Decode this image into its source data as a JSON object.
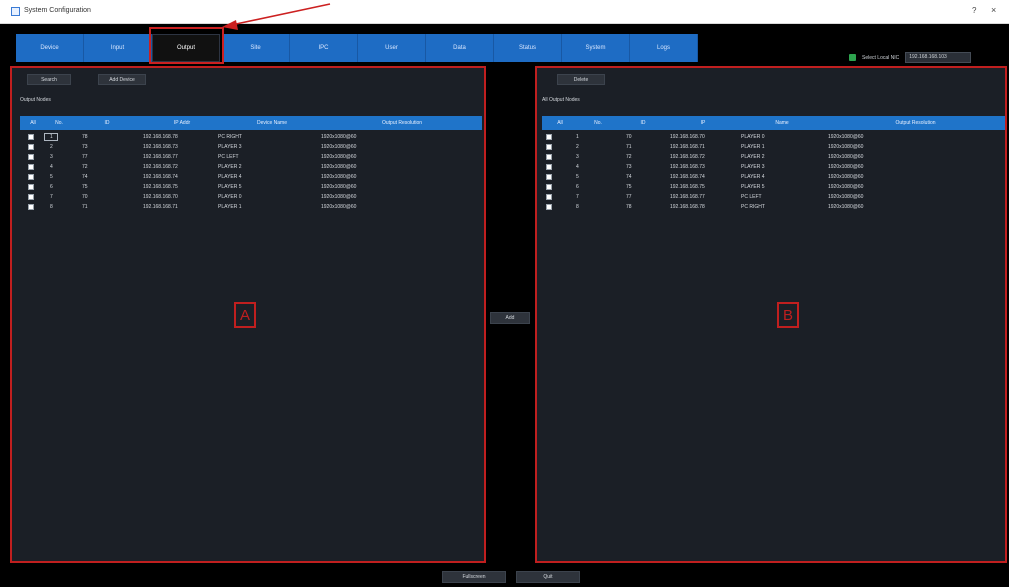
{
  "window": {
    "title": "System Configuration",
    "help": "?",
    "close": "×"
  },
  "tabs": [
    {
      "label": "Device"
    },
    {
      "label": "Input"
    },
    {
      "label": "Output"
    },
    {
      "label": "Site"
    },
    {
      "label": "IPC"
    },
    {
      "label": "User"
    },
    {
      "label": "Data"
    },
    {
      "label": "Status"
    },
    {
      "label": "System"
    },
    {
      "label": "Logs"
    }
  ],
  "active_tab": "Output",
  "local_nic": {
    "label": "Select Local NIC",
    "value": "192.168.168.103"
  },
  "panel_a": {
    "search_label": "Search",
    "add_device_label": "Add Device",
    "title": "Output Nodes",
    "headers": [
      "All",
      "No.",
      "ID",
      "IP Addr",
      "Device Name",
      "Output Resolution"
    ],
    "rows": [
      [
        "1",
        "78",
        "192.168.168.78",
        "PC RIGHT",
        "1920x1080@60"
      ],
      [
        "2",
        "73",
        "192.168.168.73",
        "PLAYER 3",
        "1920x1080@60"
      ],
      [
        "3",
        "77",
        "192.168.168.77",
        "PC LEFT",
        "1920x1080@60"
      ],
      [
        "4",
        "72",
        "192.168.168.72",
        "PLAYER 2",
        "1920x1080@60"
      ],
      [
        "5",
        "74",
        "192.168.168.74",
        "PLAYER 4",
        "1920x1080@60"
      ],
      [
        "6",
        "75",
        "192.168.168.75",
        "PLAYER 5",
        "1920x1080@60"
      ],
      [
        "7",
        "70",
        "192.168.168.70",
        "PLAYER 0",
        "1920x1080@60"
      ],
      [
        "8",
        "71",
        "192.168.168.71",
        "PLAYER 1",
        "1920x1080@60"
      ]
    ],
    "marker": "A"
  },
  "add_label": "Add",
  "panel_b": {
    "delete_label": "Delete",
    "title": "All Output Nodes",
    "headers": [
      "All",
      "No.",
      "ID",
      "IP",
      "Name",
      "Output Resolution"
    ],
    "rows": [
      [
        "1",
        "70",
        "192.168.168.70",
        "PLAYER 0",
        "1920x1080@60"
      ],
      [
        "2",
        "71",
        "192.168.168.71",
        "PLAYER 1",
        "1920x1080@60"
      ],
      [
        "3",
        "72",
        "192.168.168.72",
        "PLAYER 2",
        "1920x1080@60"
      ],
      [
        "4",
        "73",
        "192.168.168.73",
        "PLAYER 3",
        "1920x1080@60"
      ],
      [
        "5",
        "74",
        "192.168.168.74",
        "PLAYER 4",
        "1920x1080@60"
      ],
      [
        "6",
        "75",
        "192.168.168.75",
        "PLAYER 5",
        "1920x1080@60"
      ],
      [
        "7",
        "77",
        "192.168.168.77",
        "PC LEFT",
        "1920x1080@60"
      ],
      [
        "8",
        "78",
        "192.168.168.78",
        "PC RIGHT",
        "1920x1080@60"
      ]
    ],
    "marker": "B"
  },
  "bottom": {
    "fullscreen_label": "Fullscreen",
    "quit_label": "Quit"
  },
  "colors": {
    "accent": "#1f74c9",
    "annotation": "#c01f1f",
    "panel_bg": "#1b1f26"
  }
}
